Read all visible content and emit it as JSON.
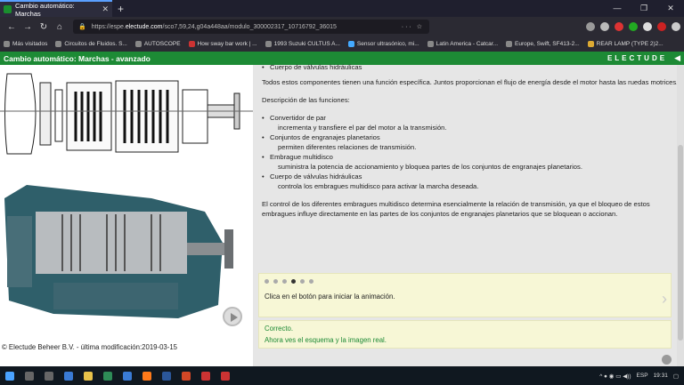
{
  "browser": {
    "tab_title": "Cambio automático: Marchas",
    "new_tab": "+",
    "url_prefix": "https://espe.",
    "url_domain": "electude.com",
    "url_rest": "/sco7,59,24,g04a448aa/modulo_300002317_10716792_36015",
    "url_tail": "··· ☆",
    "bookmarks": [
      "Más visitados",
      "Circuitos de Fluidos. S...",
      "AUTOSCOPE",
      "How sway bar work | ...",
      "1993 Suzuki CULTUS A...",
      "Sensor ultrasónico, mi...",
      "Latin America - Catcar...",
      "Europe, Swift, SF413-2...",
      "REAR LAMP (TYPE 2)2..."
    ]
  },
  "app": {
    "title": "Cambio automático: Marchas - avanzado",
    "brand": "ELECTUDE"
  },
  "content": {
    "top_bullet": "Cuerpo de válvulas hidráulicas",
    "intro": "Todos estos componentes tienen una función específica. Juntos proporcionan el flujo de energía desde el motor hasta las ruedas motrices.",
    "desc_heading": "Descripción de las funciones:",
    "functions": [
      {
        "name": "Convertidor de par",
        "desc": "incrementa y transfiere el par del motor a la transmisión."
      },
      {
        "name": "Conjuntos de engranajes planetarios",
        "desc": "permiten diferentes relaciones de transmisión."
      },
      {
        "name": "Embrague multidisco",
        "desc": "suministra la potencia de accionamiento y bloquea partes de los conjuntos de engranajes planetarios."
      },
      {
        "name": "Cuerpo de válvulas hidráulicas",
        "desc": "controla los embragues multidisco para activar la marcha deseada."
      }
    ],
    "control_text": "El control de los diferentes embragues multidisco determina esencialmente la relación de transmisión, ya que el bloqueo de estos embragues influye directamente en las partes de los conjuntos de engranajes planetarios que se bloquean o accionan."
  },
  "animation": {
    "steps": 6,
    "active_step": 4,
    "message": "Clica en el botón para iniciar la animación."
  },
  "feedback": {
    "line1": "Correcto.",
    "line2": "Ahora ves el esquema y la imagen real."
  },
  "footer": {
    "copyright": "© Electude Beheer B.V. - última modificación:2019-03-15"
  },
  "taskbar": {
    "lang": "ESP",
    "time": "19:31"
  },
  "colors": {
    "brand_green": "#1d8a35",
    "panel_yellow": "#f7f7d6"
  }
}
